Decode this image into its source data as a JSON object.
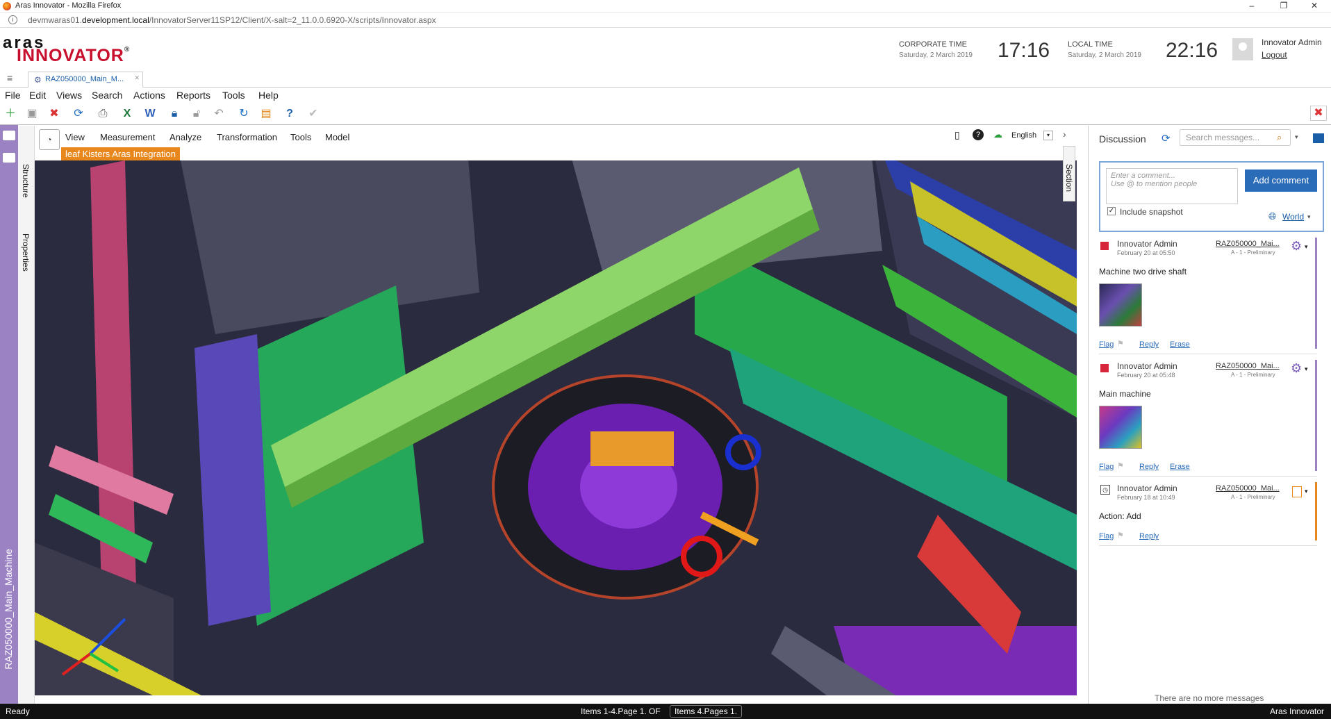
{
  "browser": {
    "title": "Aras Innovator - Mozilla Firefox",
    "url_prefix": "devmwaras01.",
    "url_domain": "development.local",
    "url_path": "/InnovatorServer11SP12/Client/X-salt=2_11.0.0.6920-X/scripts/Innovator.aspx",
    "minimize": "–",
    "maximize": "❐",
    "close": "✕"
  },
  "header": {
    "logo_top": "aras",
    "logo_bottom": "INNOVATOR",
    "logo_mark": "®",
    "corporate_label": "CORPORATE TIME",
    "corporate_date": "Saturday, 2 March 2019",
    "corporate_time": "17:16",
    "local_label": "LOCAL TIME",
    "local_date": "Saturday, 2 March 2019",
    "local_time": "22:16",
    "user": "Innovator Admin",
    "logout": "Logout"
  },
  "tab": {
    "label": "RAZ050000_Main_M...",
    "close": "✕"
  },
  "menu": [
    "File",
    "Edit",
    "Views",
    "Search",
    "Actions",
    "Reports",
    "Tools",
    "Help"
  ],
  "viewer": {
    "menu": [
      "View",
      "Measurement",
      "Analyze",
      "Transformation",
      "Tools",
      "Model"
    ],
    "language": "English",
    "banner": "leaf Kisters Aras Integration",
    "section_tab": "Section",
    "structure_tab": "Structure",
    "properties_tab": "Properties",
    "item_vertical": "RAZ050000_Main_Machine"
  },
  "discussion": {
    "title": "Discussion",
    "search_placeholder": "Search messages...",
    "comment_placeholder_1": "Enter a comment...",
    "comment_placeholder_2": "Use @ to mention people",
    "add_comment": "Add comment",
    "include_snapshot": "Include snapshot",
    "world": "World",
    "messages": [
      {
        "author": "Innovator Admin",
        "date": "February 20 at 05:50",
        "item": "RAZ050000_Mai...",
        "sub": "A - 1 - Preliminary",
        "text": "Machine two drive shaft",
        "flag": "Flag",
        "reply": "Reply",
        "erase": "Erase"
      },
      {
        "author": "Innovator Admin",
        "date": "February 20 at 05:48",
        "item": "RAZ050000_Mai...",
        "sub": "A - 1 - Preliminary",
        "text": "Main machine",
        "flag": "Flag",
        "reply": "Reply",
        "erase": "Erase"
      },
      {
        "author": "Innovator Admin",
        "date": "February 18 at 10:49",
        "item": "RAZ050000_Mai...",
        "sub": "A - 1 - Preliminary",
        "text": "Action: Add",
        "flag": "Flag",
        "reply": "Reply"
      }
    ],
    "no_more": "There are no more messages"
  },
  "status": {
    "left": "Ready",
    "page_info": "Items 1-4.Page 1. OF",
    "page_info2": "Items 4.Pages 1.",
    "right": "Aras Innovator"
  },
  "colors": {
    "brand_red": "#c8102e",
    "accent_blue": "#2b6cb8",
    "sidebar_purple": "#9b82c3",
    "banner_orange": "#e8871c"
  }
}
